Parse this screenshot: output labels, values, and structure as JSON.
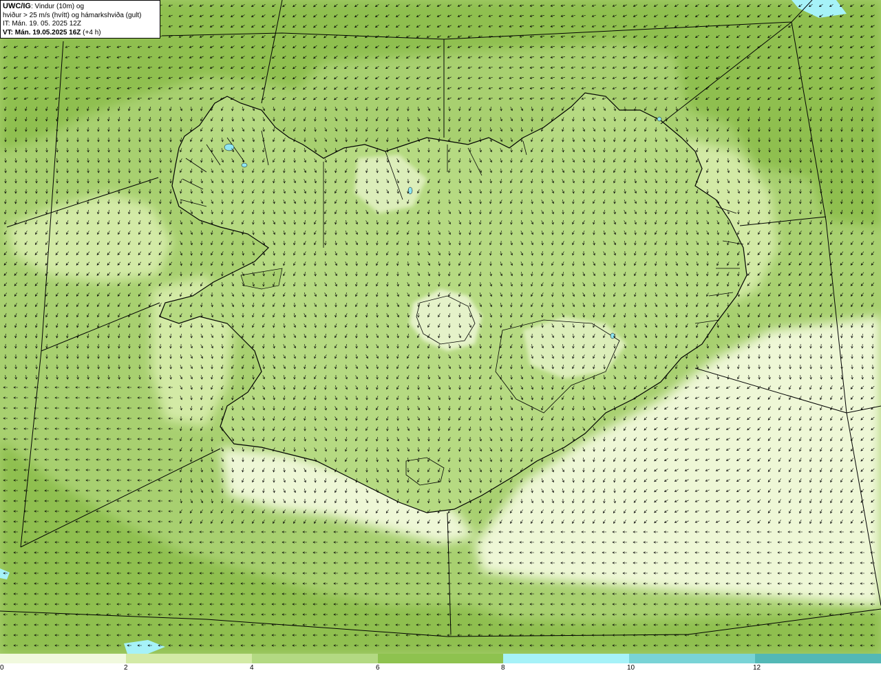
{
  "info": {
    "model_code": "UWC/IG",
    "line1_rest": ": Vindur (10m) og",
    "line2": "hviður > 25 m/s (hvítt) og hámarkshviða (gult)",
    "line3": "IT: Mán. 19. 05. 2025 12Z",
    "line4_bold": "VT: Mán. 19.05.2025 16Z",
    "line4_rest": " (+4 h)"
  },
  "colors": {
    "sea_outer": "#8fbf4f",
    "sea_mid": "#a8d070",
    "calm": "#eef7d6",
    "light": "#d3eaa6",
    "land_mid": "#b6da82",
    "lake": "#8fe6f2",
    "coast": "#000000",
    "grid": "#000000"
  },
  "legend": {
    "bins": [
      {
        "min": 0,
        "max": 2,
        "color": "#f1f9de"
      },
      {
        "min": 2,
        "max": 4,
        "color": "#d3eaa6"
      },
      {
        "min": 4,
        "max": 6,
        "color": "#b3d982"
      },
      {
        "min": 6,
        "max": 8,
        "color": "#8ec24f"
      },
      {
        "min": 8,
        "max": 10,
        "color": "#a6f2f8"
      },
      {
        "min": 10,
        "max": 12,
        "color": "#79d3d6"
      },
      {
        "min": 12,
        "max": 14,
        "color": "#53b8b6"
      }
    ],
    "tick_labels": [
      "0",
      "2",
      "4",
      "6",
      "8",
      "10",
      "12"
    ]
  }
}
